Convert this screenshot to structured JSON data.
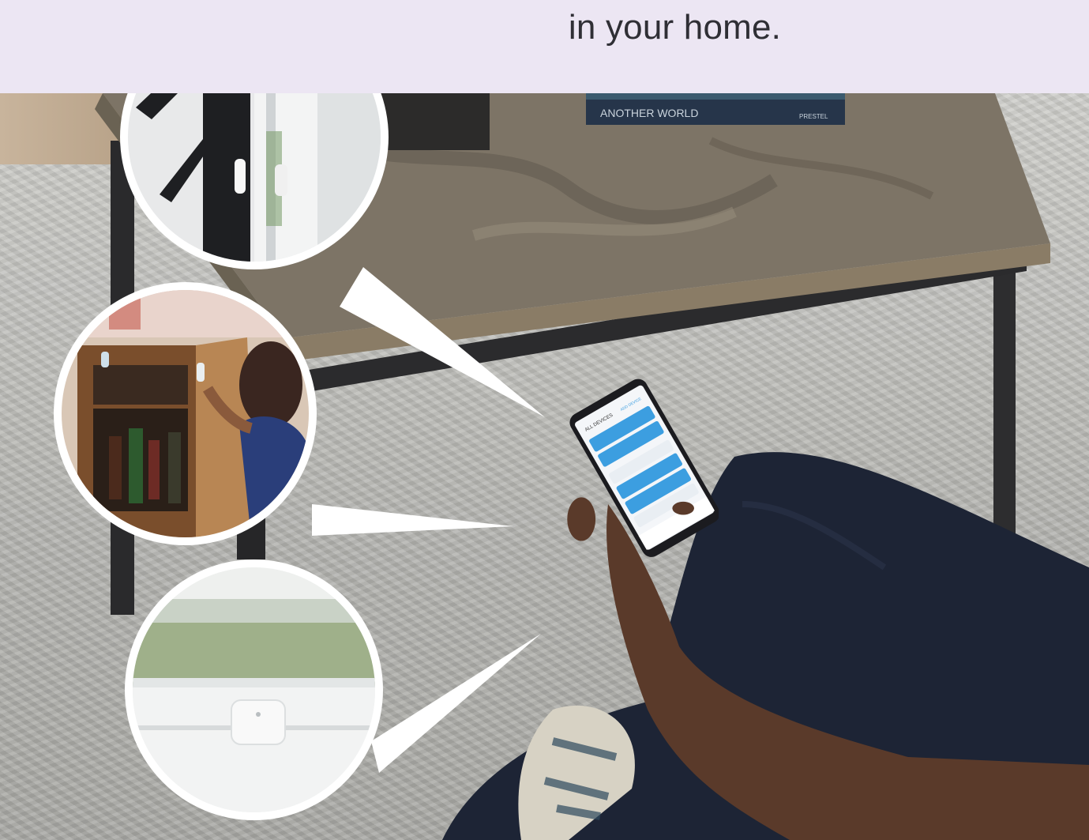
{
  "header": {
    "headline": "in your home.",
    "background_color": "#ece6f3",
    "text_color": "#2f2f35"
  },
  "book": {
    "title": "ANOTHER WORLD",
    "publisher": "PRESTEL"
  },
  "phone_screen": {
    "top_label": "ALL DEVICES",
    "action_label": "ADD DEVICE",
    "accent_color": "#3c9ee0"
  },
  "callouts": [
    {
      "name": "door-sensor-callout"
    },
    {
      "name": "cabinet-sensor-callout"
    },
    {
      "name": "window-sensor-callout"
    }
  ]
}
